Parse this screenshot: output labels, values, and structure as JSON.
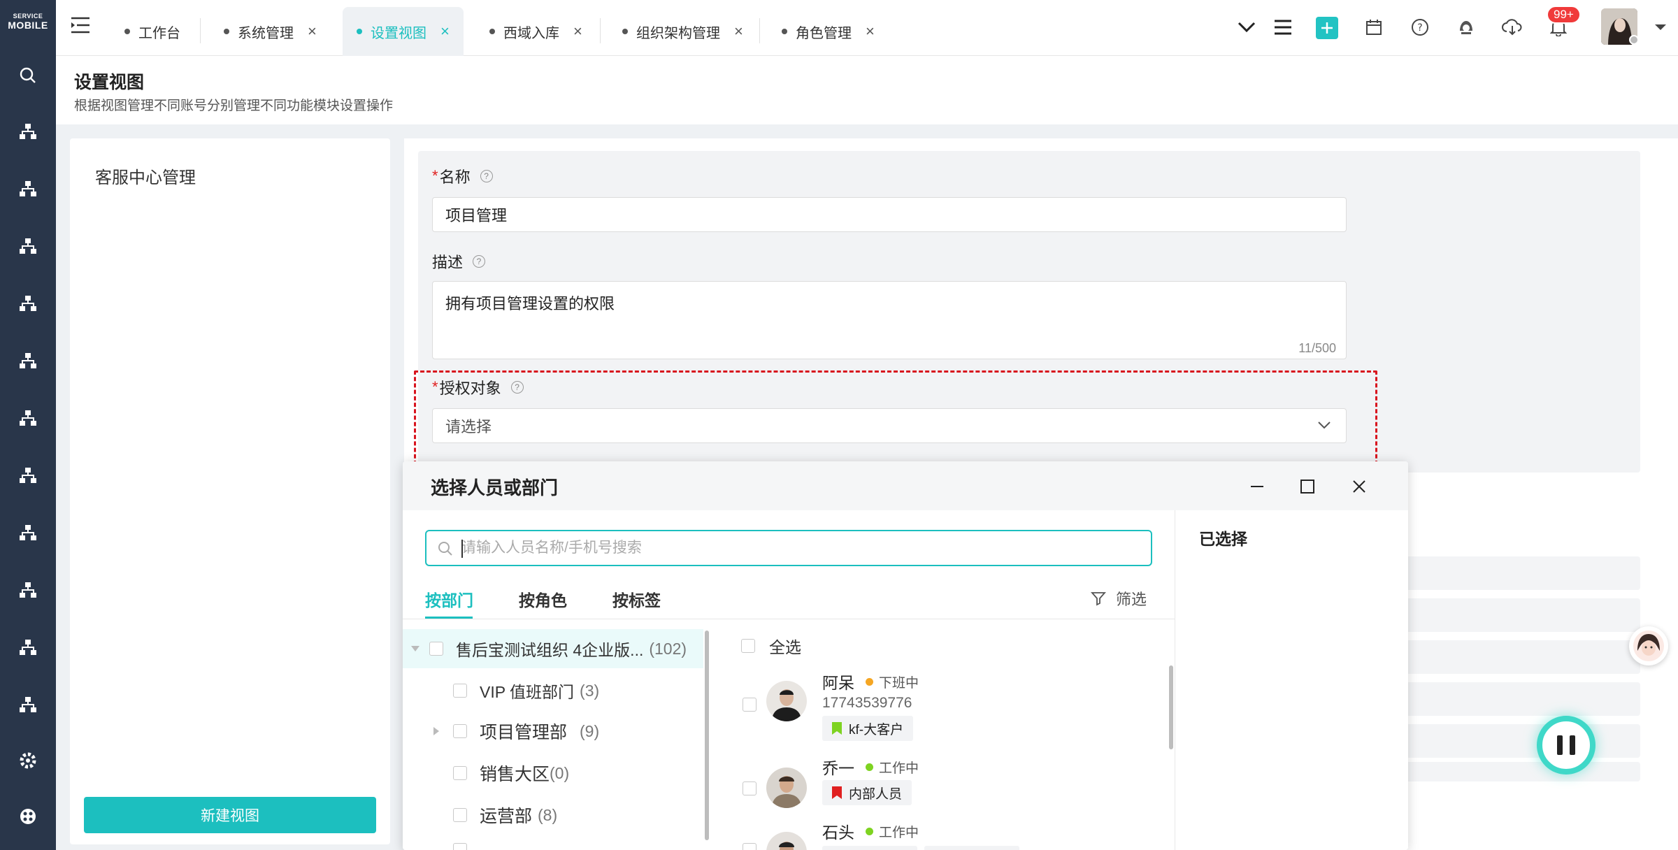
{
  "app": {
    "logo_line1": "SERVICE",
    "logo_line2": "MOBILE"
  },
  "tabs": [
    {
      "label": "工作台",
      "active": false,
      "closable": false
    },
    {
      "label": "系统管理",
      "active": false,
      "closable": true
    },
    {
      "label": "设置视图",
      "active": true,
      "closable": true
    },
    {
      "label": "西域入库",
      "active": false,
      "closable": true
    },
    {
      "label": "组织架构管理",
      "active": false,
      "closable": true
    },
    {
      "label": "角色管理",
      "active": false,
      "closable": true
    }
  ],
  "header": {
    "notification_badge": "99+",
    "icons": [
      "chevron-down-icon",
      "list-icon",
      "add-icon",
      "calendar-icon",
      "help-icon",
      "service-icon",
      "cloud-icon",
      "bell-icon"
    ]
  },
  "page": {
    "title": "设置视图",
    "subtitle": "根据视图管理不同账号分别管理不同功能模块设置操作"
  },
  "left_panel": {
    "item": "客服中心管理",
    "new_view_button": "新建视图"
  },
  "form": {
    "name_label": "名称",
    "name_value": "项目管理",
    "desc_label": "描述",
    "desc_value": "拥有项目管理设置的权限",
    "desc_counter": "11/500",
    "auth_label": "授权对象",
    "auth_placeholder": "请选择"
  },
  "modal": {
    "title": "选择人员或部门",
    "search_placeholder": "请输入人员名称/手机号搜索",
    "tabs": [
      "按部门",
      "按角色",
      "按标签"
    ],
    "filter_label": "筛选",
    "selected_title": "已选择",
    "select_all": "全选",
    "tree": [
      {
        "name": "售后宝测试组织 4企业版...",
        "count": "(102)"
      },
      {
        "name": "VIP 值班部门",
        "count": "(3)"
      },
      {
        "name": "项目管理部",
        "count": "(9)"
      },
      {
        "name": "销售大区",
        "count": "(0)"
      },
      {
        "name": "运营部",
        "count": "(8)"
      }
    ],
    "people": [
      {
        "name": "阿呆",
        "status": "下班中",
        "status_color": "#f5a623",
        "phone": "17743539776",
        "tag": "kf-大客户",
        "tag_color": "#7ed321"
      },
      {
        "name": "乔一",
        "status": "工作中",
        "status_color": "#7ed321",
        "phone": "",
        "tag": "内部人员",
        "tag_color": "#e02020"
      },
      {
        "name": "石头",
        "status": "工作中",
        "status_color": "#7ed321",
        "phone": "",
        "tag": "",
        "tag_color": ""
      }
    ]
  },
  "colors": {
    "accent": "#1cbfbf",
    "rail": "#29364a",
    "highlight_border": "#d8141e"
  }
}
